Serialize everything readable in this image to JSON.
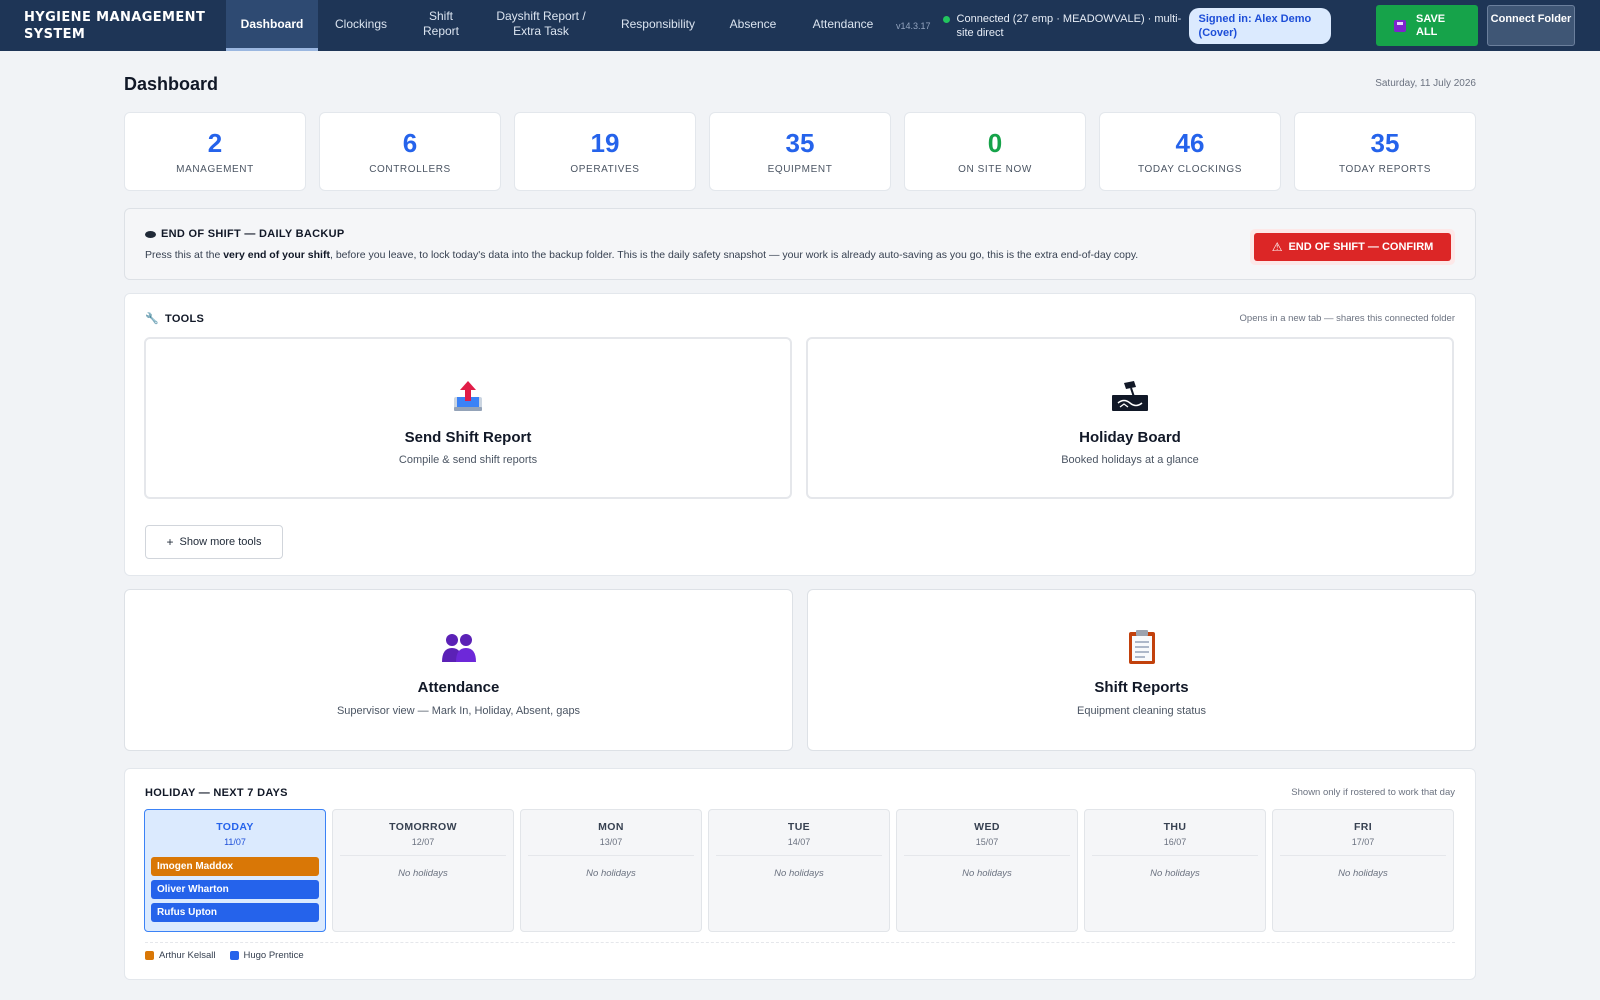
{
  "app": {
    "brand": "HYGIENE MANAGEMENT SYSTEM",
    "version": "v14.3.17",
    "connection": "Connected (27 emp · MEADOWVALE) · multi-site direct",
    "signed_in": "Signed in: Alex Demo (Cover)",
    "save_label": "SAVE ALL",
    "connect_label": "Connect Folder"
  },
  "nav": {
    "tabs": [
      {
        "label": "Dashboard",
        "active": true
      },
      {
        "label": "Clockings"
      },
      {
        "label": "Shift Report"
      },
      {
        "label": "Dayshift Report / Extra Task"
      },
      {
        "label": "Responsibility"
      },
      {
        "label": "Absence"
      },
      {
        "label": "Attendance"
      }
    ]
  },
  "page": {
    "title": "Dashboard",
    "date": "Saturday, 11 July 2026"
  },
  "stats": [
    {
      "value": "2",
      "label": "MANAGEMENT"
    },
    {
      "value": "6",
      "label": "CONTROLLERS"
    },
    {
      "value": "19",
      "label": "OPERATIVES"
    },
    {
      "value": "35",
      "label": "EQUIPMENT"
    },
    {
      "value": "0",
      "label": "ON SITE NOW",
      "color": "#16a34a"
    },
    {
      "value": "46",
      "label": "TODAY CLOCKINGS"
    },
    {
      "value": "35",
      "label": "TODAY REPORTS"
    }
  ],
  "end_of_shift": {
    "title": "END OF SHIFT — DAILY BACKUP",
    "text_before": "Press this at the ",
    "text_bold": "very end of your shift",
    "text_after": ", before you leave, to lock today's data into the backup folder. This is the daily safety snapshot — your work is already auto-saving as you go, this is the extra end-of-day copy.",
    "button": "END OF SHIFT — CONFIRM"
  },
  "tools": {
    "title": "TOOLS",
    "note": "Opens in a new tab — shares this connected folder",
    "cards": [
      {
        "name": "Send Shift Report",
        "desc": "Compile & send shift reports",
        "icon": "outbox-tray-icon"
      },
      {
        "name": "Holiday Board",
        "desc": "Booked holidays at a glance",
        "icon": "holiday-board-icon"
      }
    ],
    "more_label": "Show more tools"
  },
  "quick_links": [
    {
      "name": "Attendance",
      "desc": "Supervisor view — Mark In, Holiday, Absent, gaps",
      "icon": "people-icon"
    },
    {
      "name": "Shift Reports",
      "desc": "Equipment cleaning status",
      "icon": "clipboard-icon"
    }
  ],
  "holiday": {
    "title": "HOLIDAY — NEXT 7 DAYS",
    "note": "Shown only if rostered to work that day",
    "empty_text": "No holidays",
    "days": [
      {
        "name": "TODAY",
        "date": "11/07",
        "today": true,
        "people": [
          {
            "name": "Imogen Maddox",
            "color": "#d97706"
          },
          {
            "name": "Oliver Wharton",
            "color": "#2563eb"
          },
          {
            "name": "Rufus Upton",
            "color": "#2563eb"
          }
        ]
      },
      {
        "name": "TOMORROW",
        "date": "12/07",
        "people": []
      },
      {
        "name": "MON",
        "date": "13/07",
        "people": []
      },
      {
        "name": "TUE",
        "date": "14/07",
        "people": []
      },
      {
        "name": "WED",
        "date": "15/07",
        "people": []
      },
      {
        "name": "THU",
        "date": "16/07",
        "people": []
      },
      {
        "name": "FRI",
        "date": "17/07",
        "people": []
      }
    ],
    "legend": [
      {
        "label": "Arthur Kelsall",
        "color": "#d97706"
      },
      {
        "label": "Hugo Prentice",
        "color": "#2563eb"
      }
    ]
  }
}
